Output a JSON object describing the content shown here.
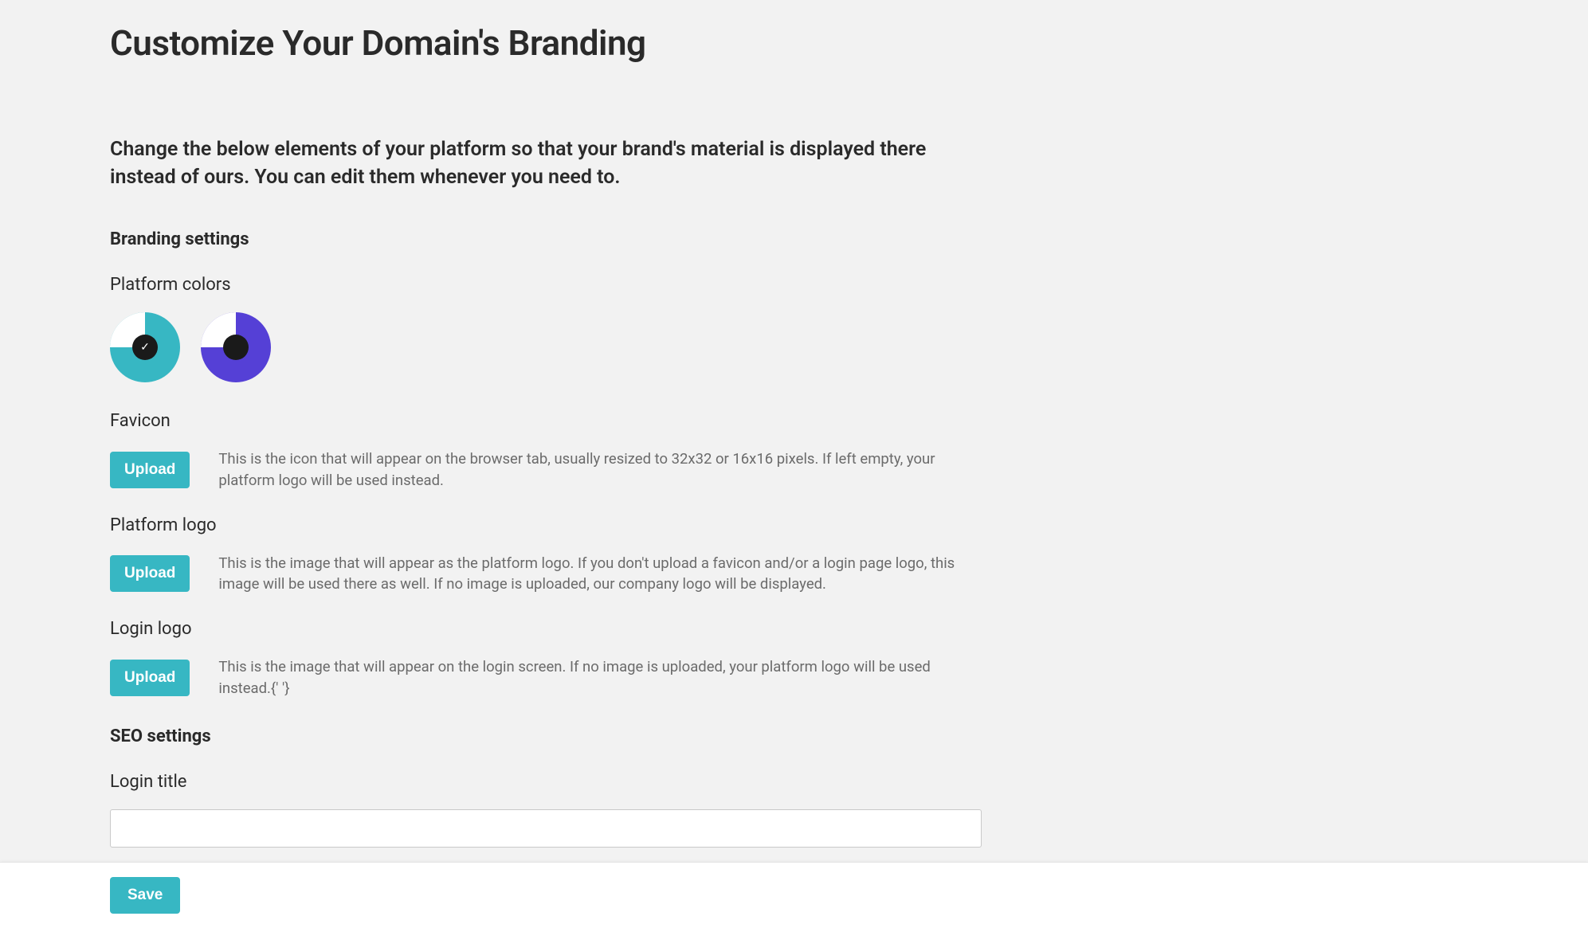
{
  "page": {
    "title": "Customize Your Domain's Branding",
    "intro": "Change the below elements of your platform so that your brand's material is displayed there instead of ours. You can edit them whenever you need to."
  },
  "branding": {
    "heading": "Branding settings",
    "colors": {
      "label": "Platform colors",
      "options": [
        {
          "name": "teal-theme",
          "primary": "#37b7c3",
          "secondary": "#ffffff",
          "selected": true
        },
        {
          "name": "purple-theme",
          "primary": "#5540d6",
          "secondary": "#ffffff",
          "selected": false
        }
      ]
    },
    "favicon": {
      "label": "Favicon",
      "button": "Upload",
      "desc": "This is the icon that will appear on the browser tab, usually resized to 32x32 or 16x16 pixels. If left empty, your platform logo will be used instead."
    },
    "platform_logo": {
      "label": "Platform logo",
      "button": "Upload",
      "desc": "This is the image that will appear as the platform logo. If you don't upload a favicon and/or a login page logo, this image will be used there as well. If no image is uploaded, our company logo will be displayed."
    },
    "login_logo": {
      "label": "Login logo",
      "button": "Upload",
      "desc": "This is the image that will appear on the login screen. If no image is uploaded, your platform logo will be used instead.{' '}"
    }
  },
  "seo": {
    "heading": "SEO settings",
    "login_title": {
      "label": "Login title",
      "value": ""
    }
  },
  "footer": {
    "save": "Save"
  }
}
